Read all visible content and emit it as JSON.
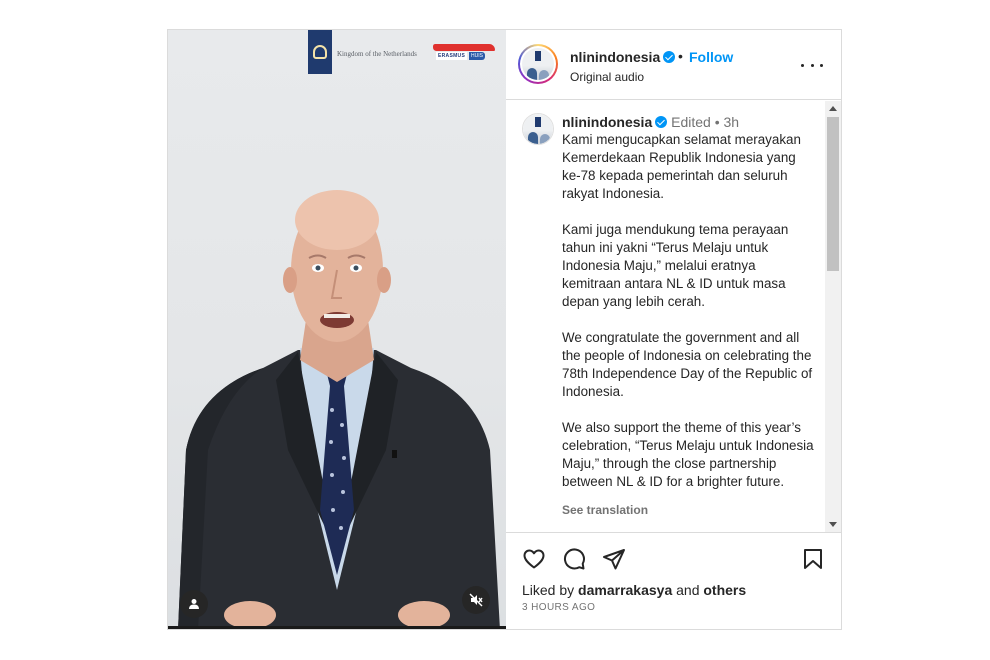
{
  "video": {
    "watermark_left": "Kingdom of the Netherlands",
    "watermark_right_tag": "ERASMUS",
    "watermark_right_huis": "HUIS"
  },
  "header": {
    "username": "nlinindonesia",
    "separator": "•",
    "follow_label": "Follow",
    "audio": "Original audio"
  },
  "caption": {
    "username": "nlinindonesia",
    "edited": "Edited",
    "separator": "•",
    "age": "3h",
    "paragraphs": [
      "Kami mengucapkan selamat merayakan Kemerdekaan Republik Indonesia yang ke-78 kepada pemerintah dan seluruh rakyat Indonesia.",
      "Kami juga mendukung tema perayaan tahun ini yakni “Terus Melaju untuk Indonesia Maju,” melalui eratnya kemitraan antara NL & ID untuk masa depan yang lebih cerah.",
      "We congratulate the government and all the people of Indonesia on celebrating the 78th Independence Day of the Republic of Indonesia.",
      "We also support the theme of this year’s celebration, “Terus Melaju untuk Indonesia Maju,” through the close partnership between NL & ID for a brighter future."
    ],
    "see_translation": "See translation"
  },
  "footer": {
    "liked_prefix": "Liked by",
    "liked_user": "damarrakasya",
    "liked_and": "and",
    "liked_others": "others",
    "timestamp": "3 hours ago"
  },
  "icons": {
    "like": "heart-icon",
    "comment": "comment-icon",
    "share": "paper-plane-icon",
    "save": "bookmark-icon",
    "more": "more-dots-icon",
    "tag": "user-tag-icon",
    "mute": "muted-speaker-icon",
    "verified": "verified-badge-icon"
  },
  "colors": {
    "accent": "#0095f6",
    "text": "#262626",
    "muted": "#737373",
    "border": "#dbdbdb"
  }
}
